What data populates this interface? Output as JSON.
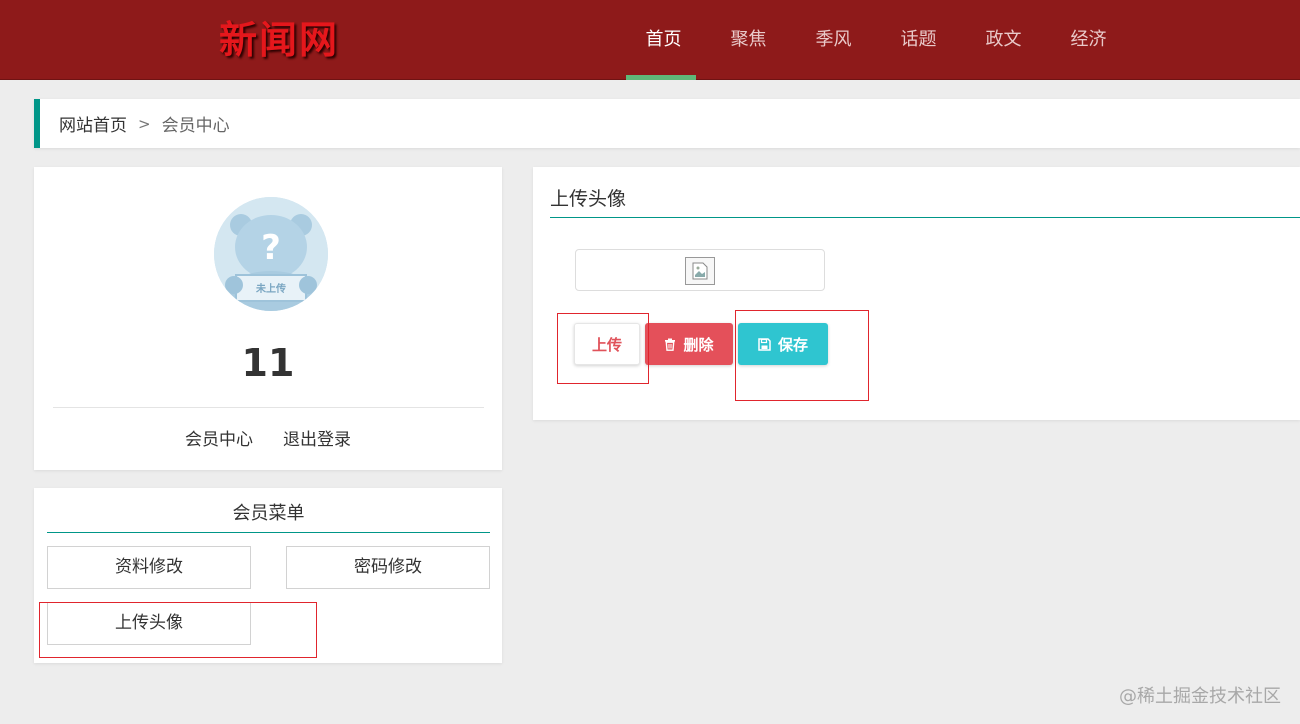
{
  "header": {
    "logo": "新闻网",
    "nav": [
      {
        "label": "首页",
        "active": true
      },
      {
        "label": "聚焦",
        "active": false
      },
      {
        "label": "季风",
        "active": false
      },
      {
        "label": "话题",
        "active": false
      },
      {
        "label": "政文",
        "active": false
      },
      {
        "label": "经济",
        "active": false
      }
    ],
    "colors": {
      "bar": "#8e1a1a",
      "logo": "#e5171c",
      "active_indicator": "#5fb878"
    }
  },
  "breadcrumb": {
    "home": "网站首页",
    "separator": ">",
    "current": "会员中心"
  },
  "profile": {
    "avatar_icon": "default-avatar-bear-icon",
    "avatar_text": "未上传",
    "username": "11",
    "links": [
      "会员中心",
      "退出登录"
    ]
  },
  "member_menu": {
    "title": "会员菜单",
    "items": [
      "资料修改",
      "密码修改",
      "上传头像"
    ]
  },
  "upload_panel": {
    "title": "上传头像",
    "preview_icon": "broken-image-icon",
    "buttons": {
      "upload": "上传",
      "delete": "删除",
      "save": "保存"
    },
    "colors": {
      "delete": "#e4505a",
      "save": "#2fc5d0",
      "upload_text": "#e0525a"
    }
  },
  "watermark": "@稀土掘金技术社区"
}
